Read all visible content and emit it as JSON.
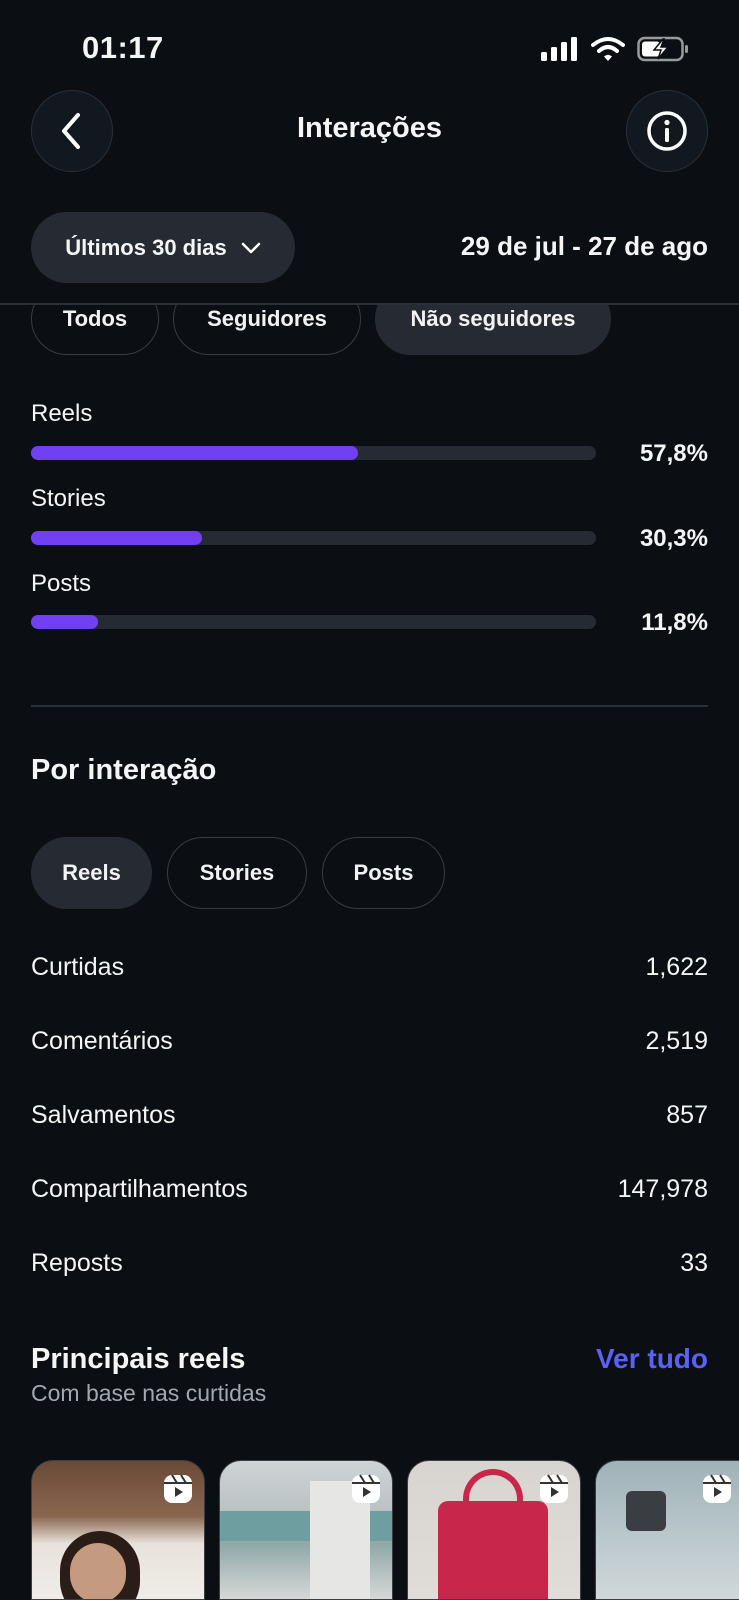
{
  "status_bar": {
    "time": "01:17"
  },
  "header": {
    "title": "Interações"
  },
  "period": {
    "selected": "Últimos 30 dias",
    "date_range": "29 de jul - 27 de ago"
  },
  "audience_tabs": [
    "Todos",
    "Seguidores",
    "Não seguidores"
  ],
  "audience_selected": "Não seguidores",
  "content_breakdown": [
    {
      "label": "Reels",
      "value_text": "57,8%",
      "fraction": 0.578
    },
    {
      "label": "Stories",
      "value_text": "30,3%",
      "fraction": 0.303
    },
    {
      "label": "Posts",
      "value_text": "11,8%",
      "fraction": 0.118
    }
  ],
  "by_interaction": {
    "title": "Por interação",
    "tabs": [
      "Reels",
      "Stories",
      "Posts"
    ],
    "selected": "Reels",
    "metrics": [
      {
        "label": "Curtidas",
        "value": "1,622"
      },
      {
        "label": "Comentários",
        "value": "2,519"
      },
      {
        "label": "Salvamentos",
        "value": "857"
      },
      {
        "label": "Compartilhamentos",
        "value": "147,978"
      },
      {
        "label": "Reposts",
        "value": "33"
      }
    ]
  },
  "top_reels": {
    "title": "Principais reels",
    "subtitle": "Com base nas curtidas",
    "see_all": "Ver tudo"
  },
  "colors": {
    "accent": "#7040f2",
    "link": "#5a62f5",
    "background": "#0b0f14"
  },
  "icons": [
    "back-chevron-icon",
    "info-icon",
    "chevron-down-icon",
    "signal-icon",
    "wifi-icon",
    "battery-charging-icon",
    "reels-icon"
  ]
}
